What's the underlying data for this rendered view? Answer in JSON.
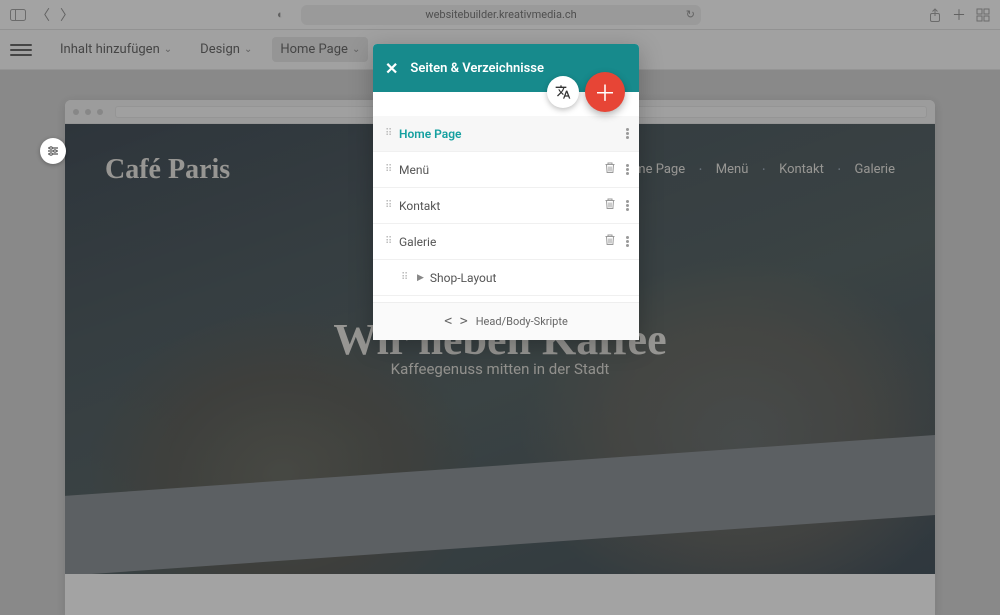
{
  "browser": {
    "url": "websitebuilder.kreativmedia.ch"
  },
  "toolbar": {
    "add_content": "Inhalt hinzufügen",
    "design": "Design",
    "current_page": "Home Page"
  },
  "popover": {
    "title": "Seiten & Verzeichnisse",
    "items": [
      {
        "label": "Home Page",
        "active": true,
        "deletable": false
      },
      {
        "label": "Menü",
        "active": false,
        "deletable": true
      },
      {
        "label": "Kontakt",
        "active": false,
        "deletable": true
      },
      {
        "label": "Galerie",
        "active": false,
        "deletable": true
      }
    ],
    "child_item": "Shop-Layout",
    "footer": "Head/Body-Skripte"
  },
  "site": {
    "logo": "Café Paris",
    "nav": [
      "Home Page",
      "Menü",
      "Kontakt",
      "Galerie"
    ],
    "hero_title": "Wir lieben Kaffee",
    "hero_sub": "Kaffeegenuss mitten in der Stadt"
  }
}
